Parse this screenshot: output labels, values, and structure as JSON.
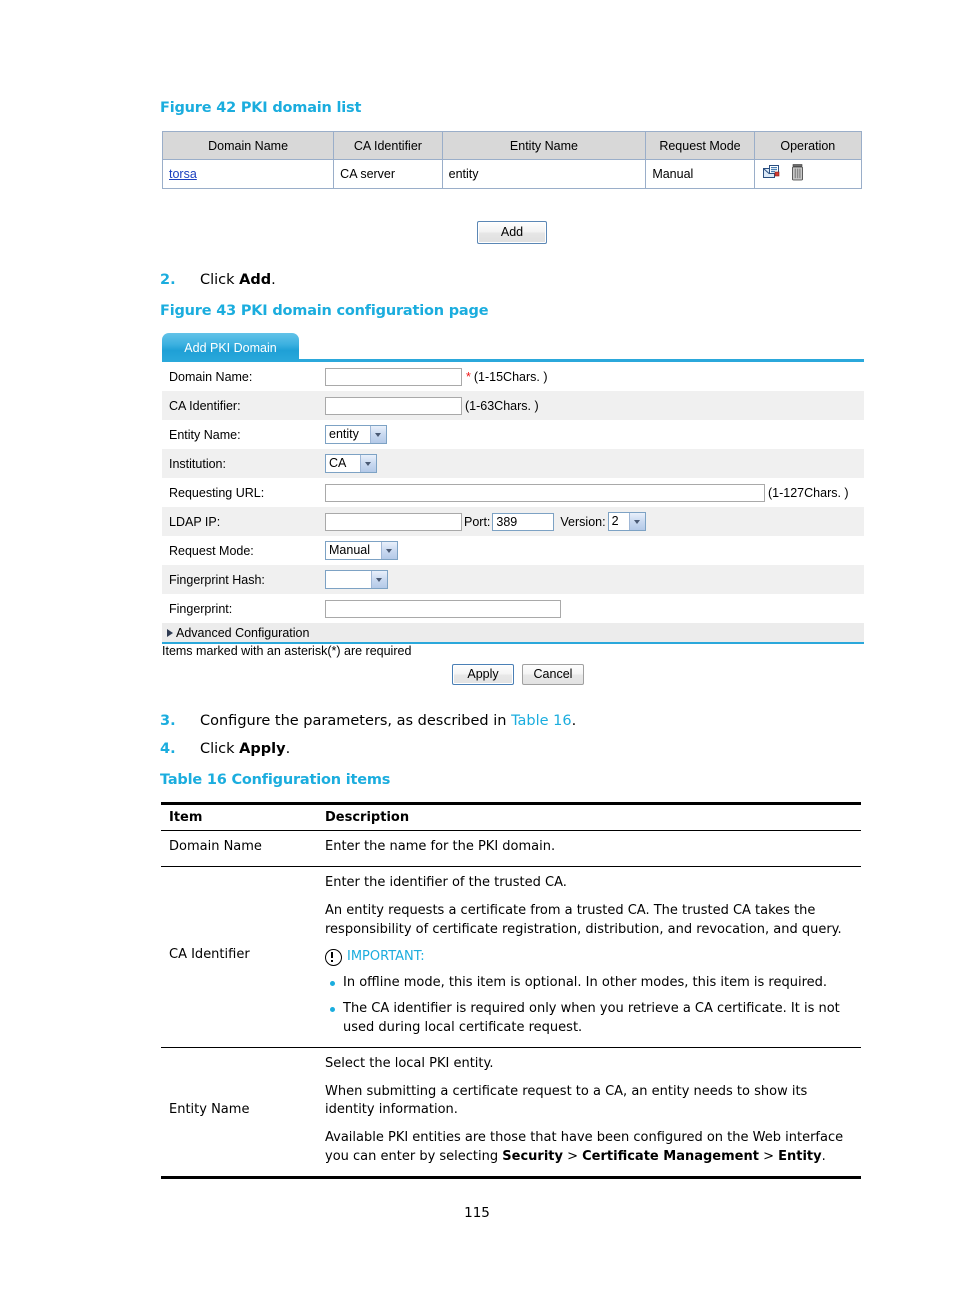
{
  "figures": {
    "fig42_caption": "Figure 42 PKI domain list",
    "fig43_caption": "Figure 43 PKI domain configuration page"
  },
  "domain_list": {
    "columns": [
      "Domain Name",
      "CA Identifier",
      "Entity Name",
      "Request Mode",
      "Operation"
    ],
    "rows": [
      {
        "domain_name": "torsa",
        "ca_identifier": "CA server",
        "entity_name": "entity",
        "request_mode": "Manual",
        "operations": [
          "certificate-icon",
          "delete-icon"
        ]
      }
    ],
    "add_button": "Add"
  },
  "steps": {
    "step2_num": "2.",
    "step2_text_prefix": "Click ",
    "step2_bold": "Add",
    "step2_suffix": ".",
    "step3_num": "3.",
    "step3_text_prefix": "Configure the parameters, as described in ",
    "step3_link": "Table 16",
    "step3_suffix": ".",
    "step4_num": "4.",
    "step4_text_prefix": "Click ",
    "step4_bold": "Apply",
    "step4_suffix": "."
  },
  "config_form": {
    "tab_label": "Add PKI Domain",
    "fields": {
      "domain_name_label": "Domain Name:",
      "domain_name_value": "",
      "domain_name_hint": "(1-15Chars. )",
      "domain_name_required": "*",
      "ca_identifier_label": "CA Identifier:",
      "ca_identifier_value": "",
      "ca_identifier_hint": "(1-63Chars. )",
      "entity_name_label": "Entity Name:",
      "entity_name_value": "entity",
      "institution_label": "Institution:",
      "institution_value": "CA",
      "requesting_url_label": "Requesting URL:",
      "requesting_url_value": "",
      "requesting_url_hint": "(1-127Chars. )",
      "ldap_ip_label": "LDAP IP:",
      "ldap_ip_value": "",
      "port_label": "Port:",
      "port_value": "389",
      "version_label": "Version:",
      "version_value": "2",
      "request_mode_label": "Request Mode:",
      "request_mode_value": "Manual",
      "fingerprint_hash_label": "Fingerprint Hash:",
      "fingerprint_hash_value": "",
      "fingerprint_label": "Fingerprint:",
      "fingerprint_value": ""
    },
    "advanced_configuration": "Advanced Configuration",
    "asterisk_note": "Items marked with an asterisk(*) are required",
    "apply_label": "Apply",
    "cancel_label": "Cancel"
  },
  "table16": {
    "caption": "Table 16 Configuration items",
    "headers": [
      "Item",
      "Description"
    ],
    "rows": [
      {
        "item": "Domain Name",
        "paragraphs": [
          "Enter the name for the PKI domain."
        ]
      },
      {
        "item": "CA Identifier",
        "paragraphs": [
          "Enter the identifier of the trusted CA.",
          "An entity requests a certificate from a trusted CA. The trusted CA takes the responsibility of certificate registration, distribution, and revocation, and query."
        ],
        "important_label": "IMPORTANT:",
        "bullets": [
          "In offline mode, this item is optional. In other modes, this item is required.",
          "The CA identifier is required only when you retrieve a CA certificate. It is not used during local certificate request."
        ]
      },
      {
        "item": "Entity Name",
        "paragraphs": [
          "Select the local PKI entity.",
          "When submitting a certificate request to a CA, an entity needs to show its identity information."
        ],
        "rich_last": {
          "prefix": "Available PKI entities are those that have been configured on the Web interface you can enter by selecting ",
          "b1": "Security",
          "sep1": " > ",
          "b2": "Certificate Management",
          "sep2": " > ",
          "b3": "Entity",
          "suffix": "."
        }
      }
    ]
  },
  "page_number": "115",
  "colors": {
    "accent_blue": "#1badde",
    "link_blue": "#1a3fbf",
    "required_red": "#ee1111",
    "table_header_gray": "#d8d8d8",
    "row_alt_gray": "#f0f0f0"
  }
}
